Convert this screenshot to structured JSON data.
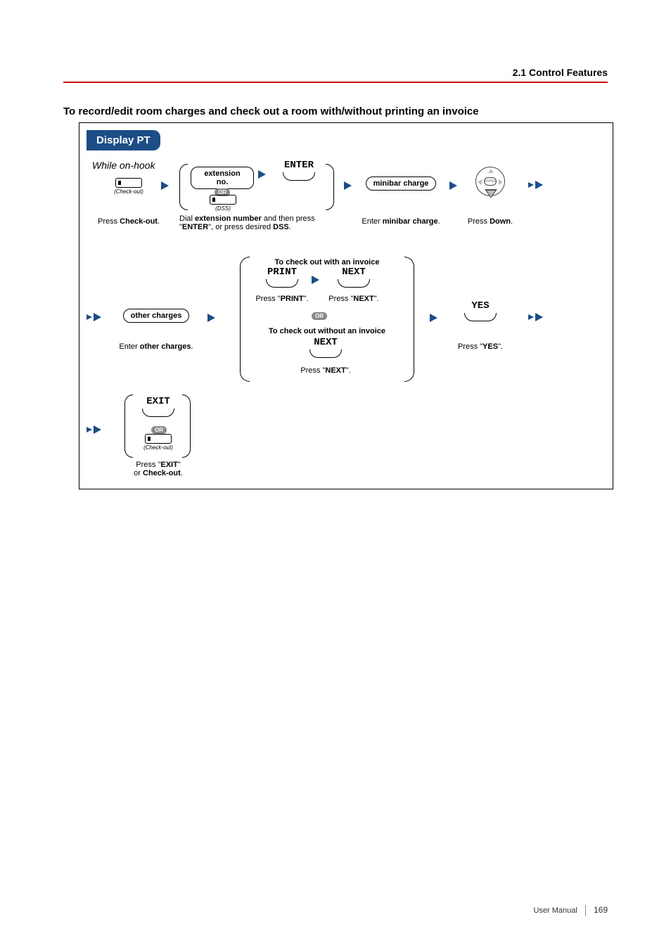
{
  "header": {
    "section": "2.1 Control Features"
  },
  "title": "To record/edit room charges and check out a room with/without printing an invoice",
  "tab": "Display PT",
  "row1": {
    "while_on_hook": "While on-hook",
    "checkout_sub": "(Check-out)",
    "step1_caption_pre": "Press ",
    "step1_caption_bold": "Check-out",
    "step1_caption_post": ".",
    "ext_pill": "extension no.",
    "or": "OR",
    "dss_sub": "(DSS)",
    "step2_line1_pre": "Dial ",
    "step2_line1_bold": "extension number",
    "step2_line1_post": " and then press",
    "step2_line2_pre": "\"",
    "step2_line2_bold": "ENTER",
    "step2_line2_mid": "\", ",
    "step2_line2_post": "or press desired ",
    "step2_line2_bold2": "DSS",
    "step2_line2_end": ".",
    "enter_key": "ENTER",
    "minibar_pill": "minibar charge",
    "step3_pre": "Enter ",
    "step3_bold": "minibar charge",
    "step3_post": ".",
    "nav_center": "ENTER",
    "step4_pre": "Press ",
    "step4_bold": "Down",
    "step4_post": "."
  },
  "row2": {
    "other_pill": "other charges",
    "other_pre": "Enter ",
    "other_bold": "other charges",
    "other_post": ".",
    "with_invoice": "To check out with an invoice",
    "print_key": "PRINT",
    "print_pre": "Press \"",
    "print_bold": "PRINT",
    "print_post": "\".",
    "next_key": "NEXT",
    "next_pre": "Press \"",
    "next_bold": "NEXT",
    "next_post": "\".",
    "or": "OR",
    "without_invoice": "To check out without an invoice",
    "next2_key": "NEXT",
    "next2_pre": "Press \"",
    "next2_bold": "NEXT",
    "next2_post": "\".",
    "yes_key": "YES",
    "yes_pre": "Press \"",
    "yes_bold": "YES",
    "yes_post": "\"."
  },
  "row3": {
    "exit_key": "EXIT",
    "or": "OR",
    "checkout_sub": "(Check-out)",
    "cap_line1_pre": "Press \"",
    "cap_line1_bold": "EXIT",
    "cap_line1_post": "\"",
    "cap_line2_pre": "or ",
    "cap_line2_bold": "Check-out",
    "cap_line2_post": "."
  },
  "footer": {
    "label": "User Manual",
    "page": "169"
  }
}
